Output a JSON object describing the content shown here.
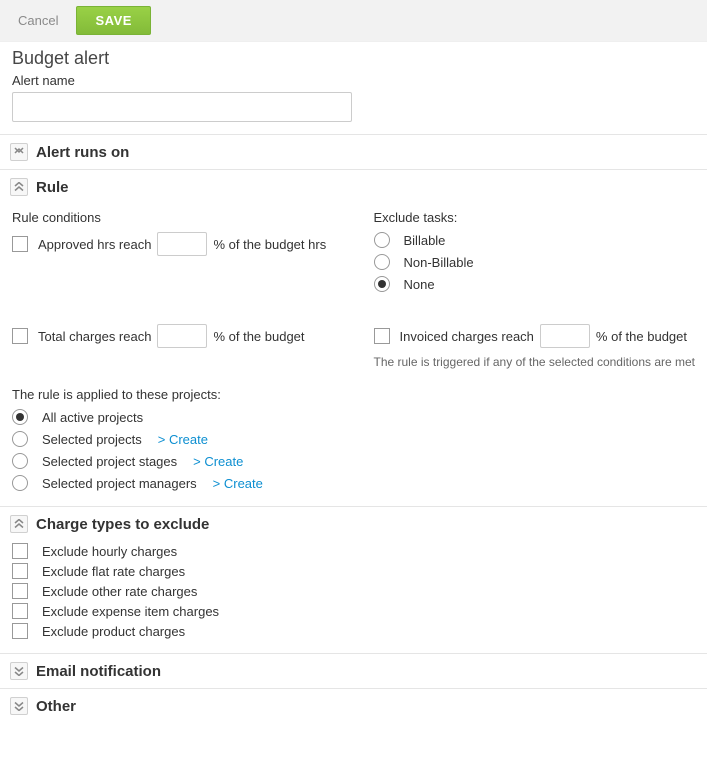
{
  "toolbar": {
    "cancel": "Cancel",
    "save": "SAVE"
  },
  "page_title": "Budget alert",
  "alert_name": {
    "label": "Alert name",
    "value": ""
  },
  "sections": {
    "runs_on": {
      "title": "Alert runs on",
      "collapsed": true
    },
    "rule": {
      "title": "Rule",
      "collapsed": false
    },
    "charges": {
      "title": "Charge types to exclude",
      "collapsed": false
    },
    "email": {
      "title": "Email notification",
      "collapsed": true
    },
    "other": {
      "title": "Other",
      "collapsed": true
    }
  },
  "rule": {
    "conditions_heading": "Rule conditions",
    "approved_hrs": {
      "prefix": "Approved hrs reach",
      "value": "",
      "suffix": "% of the budget hrs",
      "checked": false
    },
    "total_charges": {
      "prefix": "Total charges reach",
      "value": "",
      "suffix": "% of the budget",
      "checked": false
    },
    "invoiced_charges": {
      "prefix": "Invoiced charges reach",
      "value": "",
      "suffix": "% of the budget",
      "checked": false
    },
    "exclude_tasks": {
      "heading": "Exclude tasks:",
      "options": [
        "Billable",
        "Non-Billable",
        "None"
      ],
      "selected": "None"
    },
    "trigger_note": "The rule is triggered if any of the selected conditions are met",
    "applied_heading": "The rule is applied to these projects:",
    "apply_to": {
      "options": [
        {
          "label": "All active projects",
          "create": false
        },
        {
          "label": "Selected projects",
          "create": true
        },
        {
          "label": "Selected project stages",
          "create": true
        },
        {
          "label": "Selected project managers",
          "create": true
        }
      ],
      "selected": "All active projects",
      "create_link": "> Create"
    }
  },
  "charge_excludes": [
    {
      "label": "Exclude hourly charges",
      "checked": false
    },
    {
      "label": "Exclude flat rate charges",
      "checked": false
    },
    {
      "label": "Exclude other rate charges",
      "checked": false
    },
    {
      "label": "Exclude expense item charges",
      "checked": false
    },
    {
      "label": "Exclude product charges",
      "checked": false
    }
  ]
}
